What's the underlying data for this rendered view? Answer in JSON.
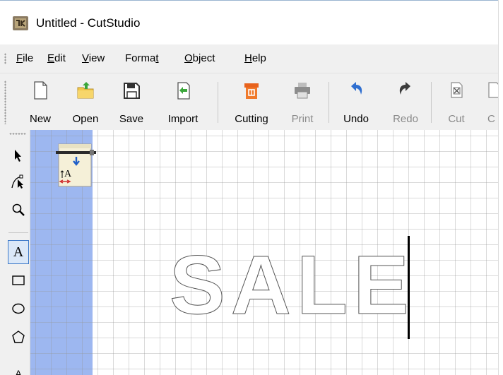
{
  "window": {
    "title": "Untitled - CutStudio",
    "app_icon": "cutstudio-app-icon"
  },
  "menu": {
    "items": [
      {
        "label": "File",
        "accel": "F",
        "rest": "ile"
      },
      {
        "label": "Edit",
        "accel": "E",
        "rest": "dit"
      },
      {
        "label": "View",
        "accel": "V",
        "rest": "iew"
      },
      {
        "label": "Format",
        "pre": "Forma",
        "accel": "t",
        "rest": ""
      },
      {
        "label": "Object",
        "accel": "O",
        "rest": "bject"
      },
      {
        "label": "Help",
        "accel": "H",
        "rest": "elp"
      }
    ]
  },
  "toolbar": {
    "buttons": [
      {
        "label": "New",
        "icon": "new-document-icon",
        "enabled": true
      },
      {
        "label": "Open",
        "icon": "open-folder-icon",
        "enabled": true
      },
      {
        "label": "Save",
        "icon": "save-floppy-icon",
        "enabled": true
      },
      {
        "label": "Import",
        "icon": "import-icon",
        "enabled": true
      },
      {
        "label": "Cutting",
        "icon": "cutting-icon",
        "enabled": true
      },
      {
        "label": "Print",
        "icon": "printer-icon",
        "enabled": false
      },
      {
        "label": "Undo",
        "icon": "undo-icon",
        "enabled": true
      },
      {
        "label": "Redo",
        "icon": "redo-icon",
        "enabled": false
      },
      {
        "label": "Cut",
        "icon": "cut-icon",
        "enabled": false
      },
      {
        "label": "C",
        "icon": "copy-icon",
        "enabled": false
      }
    ]
  },
  "side_tools": [
    {
      "name": "select-arrow-icon"
    },
    {
      "name": "node-edit-icon"
    },
    {
      "name": "zoom-magnifier-icon"
    },
    {
      "name": "text-tool-icon",
      "active": true
    },
    {
      "name": "rectangle-tool-icon"
    },
    {
      "name": "ellipse-tool-icon"
    },
    {
      "name": "polygon-tool-icon"
    }
  ],
  "canvas": {
    "text": "SALE",
    "media_icon": "media-settings-icon",
    "colors": {
      "margin": "#9db7f0",
      "grid": "#cccccc",
      "outline": "#555555"
    }
  }
}
